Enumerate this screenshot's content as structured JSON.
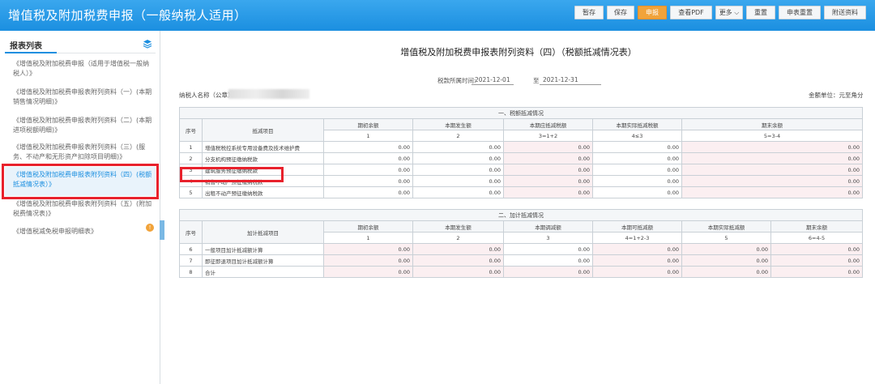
{
  "app_title": "增值税及附加税费申报（一般纳税人适用）",
  "toolbar": [
    "暂存",
    "保存",
    "申报",
    "查看PDF",
    "更多",
    "重置",
    "申表重置",
    "附送资料"
  ],
  "sidebar": {
    "title": "报表列表",
    "items": [
      "《增值税及附加税费申报（适用于增值税一般纳税人）》",
      "《增值税及附加税费申报表附列资料（一）(本期销售情况明细)》",
      "《增值税及附加税费申报表附列资料（二）(本期进项税额明细)》",
      "《增值税及附加税费申报表附列资料（三）(服务、不动产和无形资产扣除项目明细)》",
      "《增值税及附加税费申报表附列资料（四）(税额抵减情况表）》",
      "《增值税及附加税费申报表附列资料（五）(附加税费情况表)》",
      "《增值税减免税申报明细表》"
    ],
    "badge": "!"
  },
  "doc": {
    "title": "增值税及附加税费申报表附列资料（四）（税额抵减情况表）",
    "period_label": "税款所属时间:",
    "period_start": "2021-12-01",
    "period_to": "至",
    "period_end": "2021-12-31",
    "taxpayer_label": "纳税人名称（公章）：",
    "unit": "金额单位：元至角分"
  },
  "section1": {
    "title": "一、税额抵减情况",
    "headers": [
      "序号",
      "抵减项目",
      "期初余额",
      "本期发生额",
      "本期应抵减税额",
      "本期实际抵减税额",
      "期末余额"
    ],
    "formulas": [
      "1",
      "2",
      "3=1+2",
      "4≤3",
      "5=3-4"
    ],
    "rows": [
      {
        "no": "1",
        "name": "增值税税控系统专用设备费及技术维护费",
        "v1": "0.00",
        "v2": "0.00",
        "v3": "0.00",
        "v4": "0.00",
        "v5": "0.00"
      },
      {
        "no": "2",
        "name": "分支机构预征缴纳税款",
        "v1": "0.00",
        "v2": "0.00",
        "v3": "0.00",
        "v4": "0.00",
        "v5": "0.00"
      },
      {
        "no": "3",
        "name": "建筑服务预征缴纳税款",
        "v1": "0.00",
        "v2": "0.00",
        "v3": "0.00",
        "v4": "0.00",
        "v5": "0.00"
      },
      {
        "no": "4",
        "name": "销售不动产预征缴纳税款",
        "v1": "0.00",
        "v2": "0.00",
        "v3": "0.00",
        "v4": "0.00",
        "v5": "0.00"
      },
      {
        "no": "5",
        "name": "出租不动产预征缴纳税款",
        "v1": "0.00",
        "v2": "0.00",
        "v3": "0.00",
        "v4": "0.00",
        "v5": "0.00"
      }
    ]
  },
  "section2": {
    "title": "二、加计抵减情况",
    "headers": [
      "序号",
      "加计抵减项目",
      "期初余额",
      "本期发生额",
      "本期调减额",
      "本期可抵减额",
      "本期实际抵减额",
      "期末余额"
    ],
    "formulas": [
      "1",
      "2",
      "3",
      "4=1+2-3",
      "5",
      "6=4-5"
    ],
    "rows": [
      {
        "no": "6",
        "name": "一般项目加计抵减额计算",
        "v1": "0.00",
        "v2": "0.00",
        "v3": "0.00",
        "v4": "0.00",
        "v5": "0.00",
        "v6": "0.00"
      },
      {
        "no": "7",
        "name": "即征即退项目加计抵减额计算",
        "v1": "0.00",
        "v2": "0.00",
        "v3": "0.00",
        "v4": "0.00",
        "v5": "0.00",
        "v6": "0.00"
      },
      {
        "no": "8",
        "name": "合计",
        "v1": "0.00",
        "v2": "0.00",
        "v3": "0.00",
        "v4": "0.00",
        "v5": "0.00",
        "v6": "0.00"
      }
    ]
  }
}
